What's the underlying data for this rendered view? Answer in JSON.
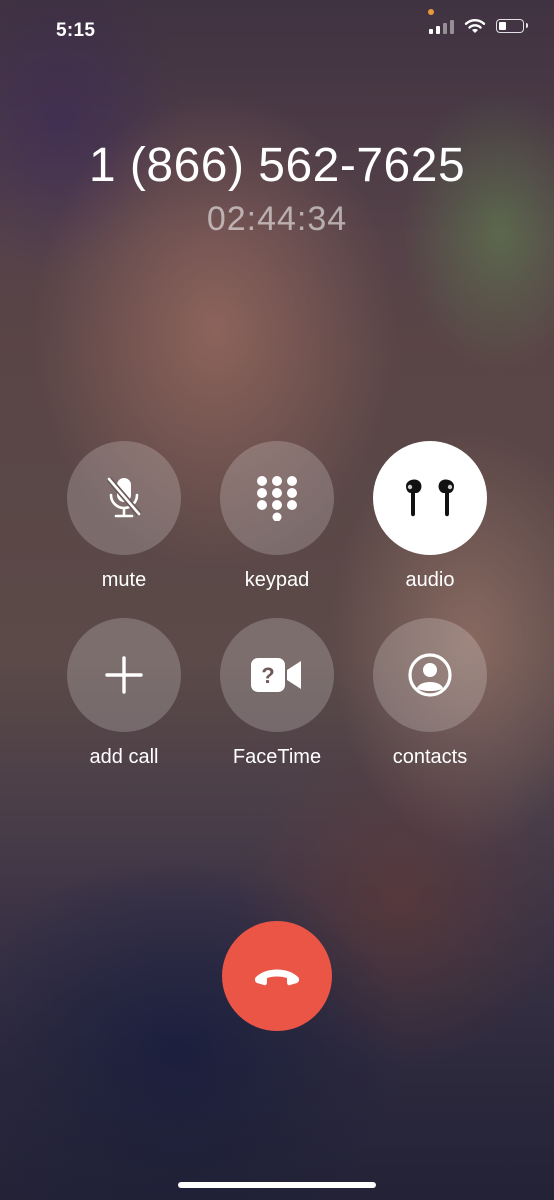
{
  "status_bar": {
    "time": "5:15",
    "icons": [
      "cellular-signal-icon",
      "wifi-icon",
      "battery-icon"
    ],
    "privacy_indicator_color": "#e89a3c"
  },
  "call": {
    "caller": "1 (866) 562-7625",
    "duration": "02:44:34"
  },
  "controls": [
    {
      "id": "mute",
      "label": "mute",
      "icon": "mic-slash-icon",
      "active": false
    },
    {
      "id": "keypad",
      "label": "keypad",
      "icon": "keypad-icon",
      "active": false
    },
    {
      "id": "audio",
      "label": "audio",
      "icon": "airpods-icon",
      "active": true
    },
    {
      "id": "add-call",
      "label": "add call",
      "icon": "plus-icon",
      "active": false
    },
    {
      "id": "facetime",
      "label": "FaceTime",
      "icon": "facetime-icon",
      "active": false
    },
    {
      "id": "contacts",
      "label": "contacts",
      "icon": "person-circle-icon",
      "active": false
    }
  ],
  "end_call": {
    "icon": "phone-down-icon",
    "color": "#eb5545"
  }
}
